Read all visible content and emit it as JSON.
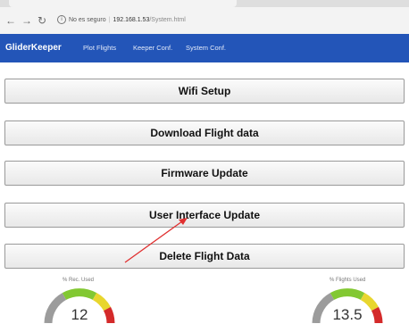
{
  "browser": {
    "back_icon": "arrow-left",
    "forward_icon": "arrow-right",
    "reload_icon": "reload",
    "security_text": "No es seguro",
    "host": "192.168.1.53",
    "path": "/System.html"
  },
  "navbar": {
    "brand": "GliderKeeper",
    "links": [
      "Plot Flights",
      "Keeper Conf.",
      "System Conf."
    ],
    "color": "#2355b8"
  },
  "buttons": [
    "Wifi Setup",
    "Download Flight data",
    "Firmware Update",
    "User Interface Update",
    "Delete Flight Data"
  ],
  "gauges": [
    {
      "label": "% Rec. Used",
      "value": "12",
      "fill_percent": 12
    },
    {
      "label": "% Flights Used",
      "value": "13.5",
      "fill_percent": 13.5
    }
  ],
  "annotation": {
    "color": "#e03030",
    "points_to": "User Interface Update"
  }
}
